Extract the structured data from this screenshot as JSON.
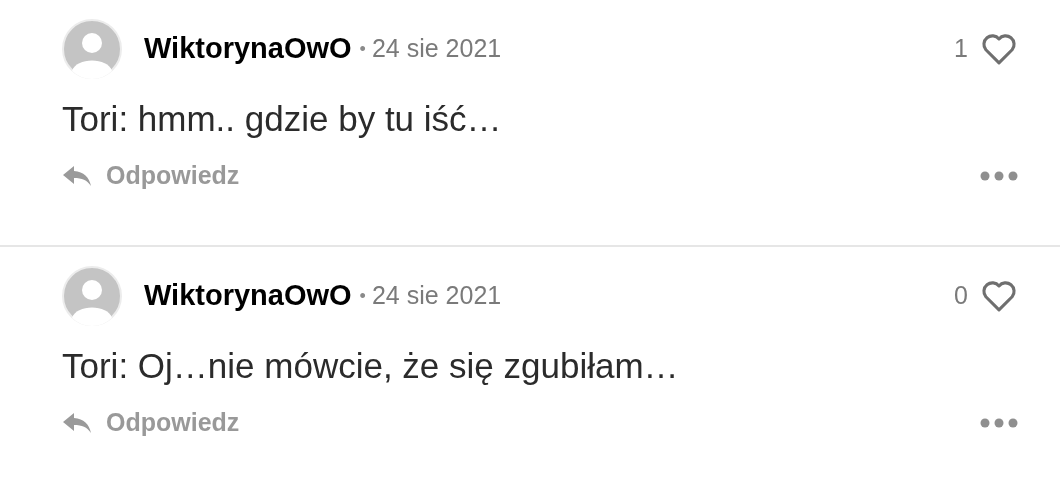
{
  "comments": [
    {
      "author": "WiktorynaOwO",
      "separator": "•",
      "date": "24 sie 2021",
      "likes": "1",
      "text": "Tori: hmm.. gdzie by tu iść…",
      "reply": "Odpowiedz"
    },
    {
      "author": "WiktorynaOwO",
      "separator": "•",
      "date": "24 sie 2021",
      "likes": "0",
      "text": "Tori: Oj…nie mówcie, że się zgubiłam…",
      "reply": "Odpowiedz"
    }
  ]
}
